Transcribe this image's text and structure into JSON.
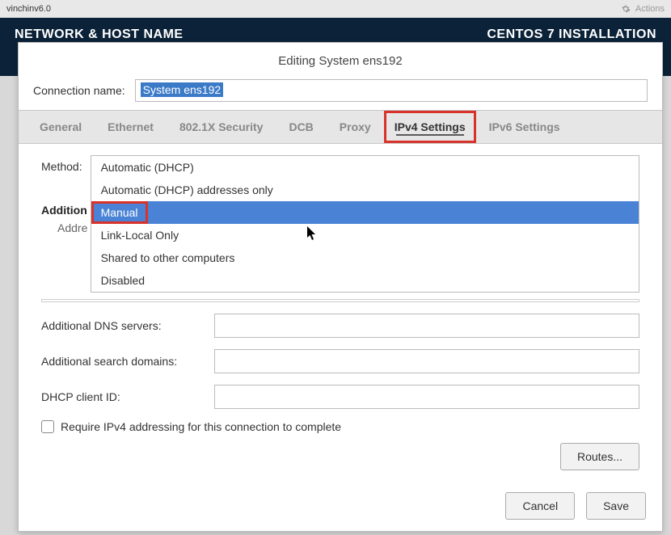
{
  "topbar": {
    "title": "vinchinv6.0",
    "actions_label": "Actions"
  },
  "header": {
    "left": "NETWORK & HOST NAME",
    "right": "CENTOS 7 INSTALLATION"
  },
  "dialog": {
    "title": "Editing System ens192",
    "connection_name_label": "Connection name:",
    "connection_name_value": "System ens192"
  },
  "tabs": {
    "general": "General",
    "ethernet": "Ethernet",
    "security": "802.1X Security",
    "dcb": "DCB",
    "proxy": "Proxy",
    "ipv4": "IPv4 Settings",
    "ipv6": "IPv6 Settings"
  },
  "method": {
    "label": "Method:",
    "options": {
      "auto": "Automatic (DHCP)",
      "auto_addr": "Automatic (DHCP) addresses only",
      "manual": "Manual",
      "linklocal": "Link-Local Only",
      "shared": "Shared to other computers",
      "disabled": "Disabled"
    }
  },
  "partial_labels": {
    "addition": "Addition",
    "addre": "Addre"
  },
  "fields": {
    "dns_label": "Additional DNS servers:",
    "search_label": "Additional search domains:",
    "dhcp_id_label": "DHCP client ID:"
  },
  "checkbox": {
    "require_label": "Require IPv4 addressing for this connection to complete"
  },
  "buttons": {
    "routes": "Routes...",
    "cancel": "Cancel",
    "save": "Save"
  }
}
